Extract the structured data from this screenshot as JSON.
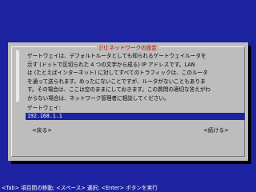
{
  "dialog": {
    "title": "[!!] ネットワークの設定",
    "description": "ゲートウェイは、デフォルトルータとしても知られるゲートウェイルータを\n示す (ドットで区切られた 4 つの文字から成る) IP アドレスです。LAN\nは (たとえばインターネット) に対してすべてのトラフィックは、このルータ\nを通って送られます。めったにないことですが、ルータがないこともありま\nす。その場合は、ここは空のままにしておきます。この質問の適切な答えがわ\nからない場合は、ネットワーク管理者に相談してください。",
    "field_label": "ゲートウェイ:",
    "field_value": "192.168.1.1",
    "back_label": "<戻る>",
    "continue_label": "<続ける>"
  },
  "statusbar": {
    "text": "<Tab> 項目間の移動; <スペース> 選択; <Enter> ボタンを実行"
  },
  "colors": {
    "background": "#1d22a0",
    "dialog": "#bdbdbd",
    "title": "#c00000",
    "input_bg": "#1d22a0"
  }
}
